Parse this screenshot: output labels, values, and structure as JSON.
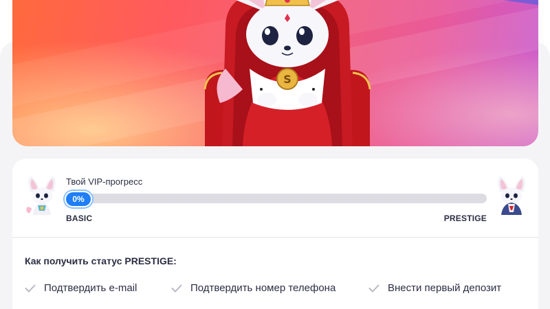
{
  "vip": {
    "progress_title": "Твой VIP-прогресс",
    "progress_value": 0,
    "progress_label": "0%",
    "level_start": "BASIC",
    "level_end": "PRESTIGE"
  },
  "howto": {
    "title": "Как получить статус PRESTIGE:",
    "steps": [
      {
        "label": "Подтвердить e-mail",
        "icon": "check-icon"
      },
      {
        "label": "Подтвердить номер телефона",
        "icon": "check-icon"
      },
      {
        "label": "Внести первый депозит",
        "icon": "check-icon"
      }
    ]
  },
  "colors": {
    "accent": "#1f7ef8",
    "track": "#dcdce2",
    "text": "#2b2d42",
    "check": "#b8b8c2"
  },
  "icons": {
    "hero_mascot": "king-fox-mascot-icon",
    "basic_avatar": "basic-fox-avatar-icon",
    "prestige_avatar": "prestige-fox-avatar-icon"
  }
}
